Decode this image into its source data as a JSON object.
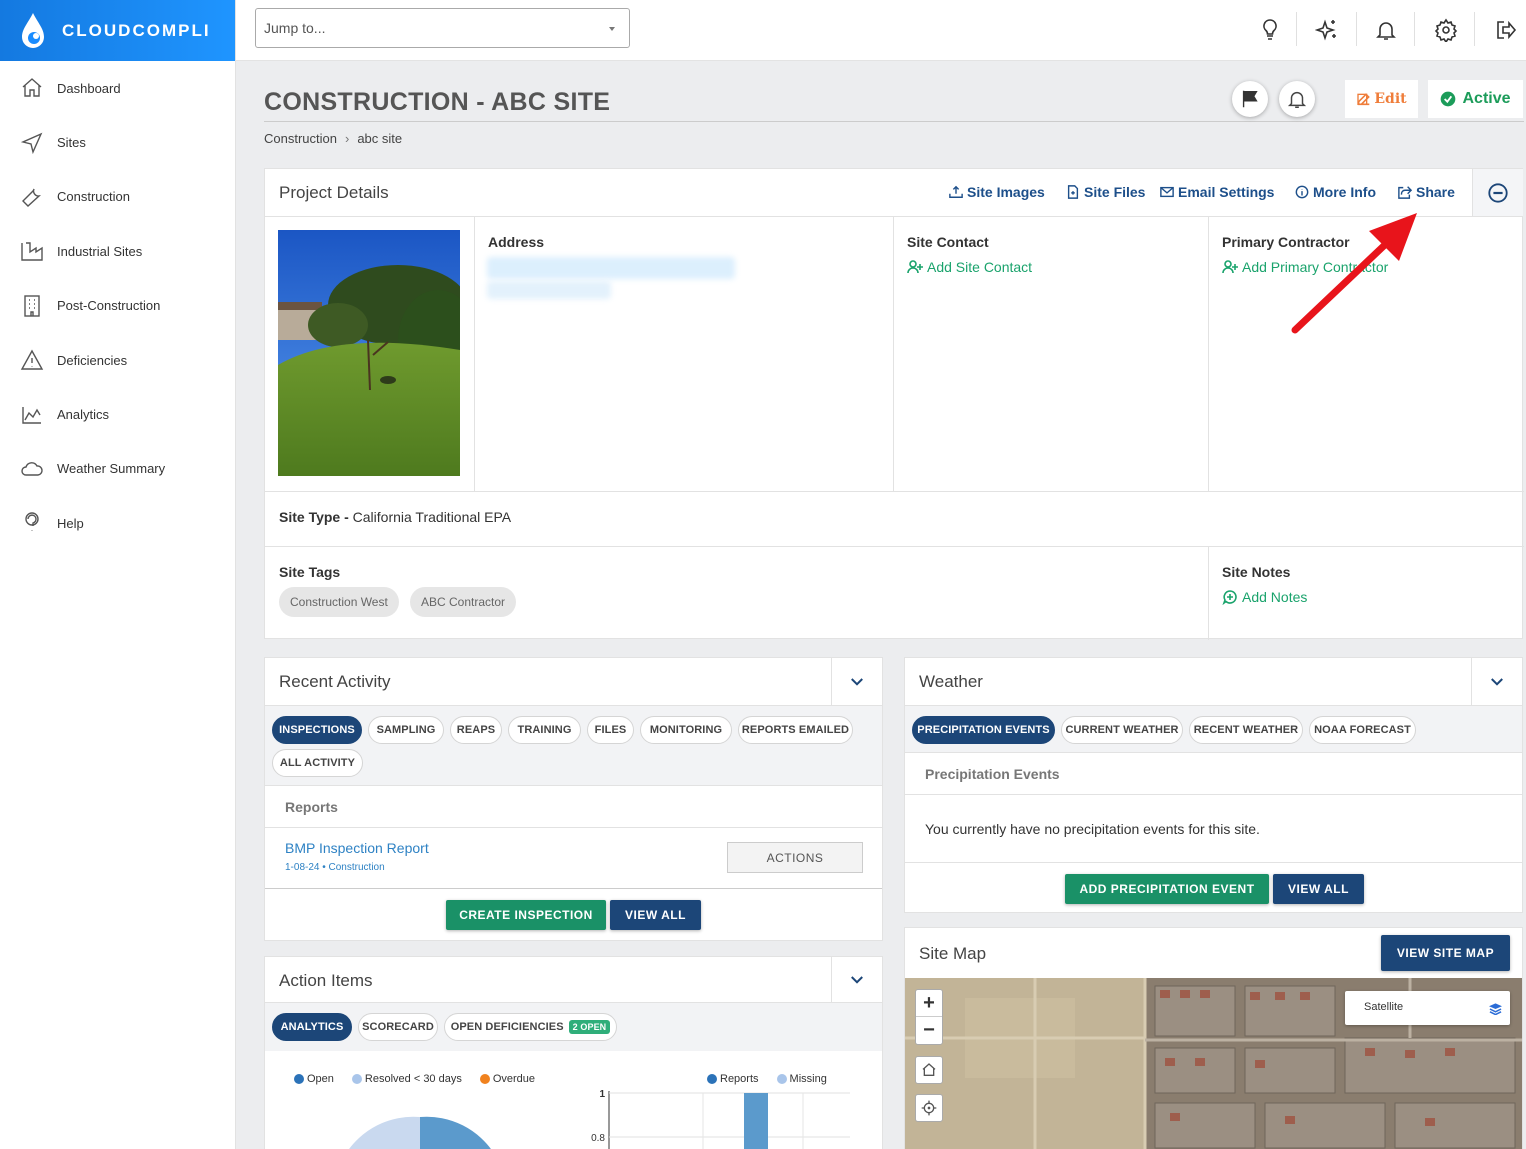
{
  "app": {
    "brand": "CLOUDCOMPLI"
  },
  "sidebar": {
    "items": [
      {
        "label": "Dashboard",
        "icon": "home-icon"
      },
      {
        "label": "Sites",
        "icon": "navigation-icon"
      },
      {
        "label": "Construction",
        "icon": "wrench-icon"
      },
      {
        "label": "Industrial Sites",
        "icon": "factory-icon"
      },
      {
        "label": "Post-Construction",
        "icon": "building-icon"
      },
      {
        "label": "Deficiencies",
        "icon": "warning-icon"
      },
      {
        "label": "Analytics",
        "icon": "chart-icon"
      },
      {
        "label": "Weather Summary",
        "icon": "cloud-icon"
      },
      {
        "label": "Help",
        "icon": "help-icon"
      }
    ]
  },
  "topbar": {
    "jump_placeholder": "Jump to..."
  },
  "header": {
    "title": "CONSTRUCTION - ABC SITE",
    "breadcrumb": [
      "Construction",
      "abc site"
    ],
    "edit_label": "Edit",
    "status_label": "Active"
  },
  "project": {
    "title": "Project Details",
    "links": [
      "Site Images",
      "Site Files",
      "Email Settings",
      "More Info",
      "Share"
    ],
    "address_label": "Address",
    "site_contact_label": "Site Contact",
    "add_site_contact": "Add Site Contact",
    "primary_contractor_label": "Primary Contractor",
    "add_primary_contractor": "Add Primary Contractor",
    "site_type_label": "Site Type -",
    "site_type_value": "California Traditional EPA",
    "site_tags_label": "Site Tags",
    "tags": [
      "Construction West",
      "ABC Contractor"
    ],
    "site_notes_label": "Site Notes",
    "add_notes": "Add Notes"
  },
  "recent_activity": {
    "title": "Recent Activity",
    "tabs": [
      "INSPECTIONS",
      "SAMPLING",
      "REAPS",
      "TRAINING",
      "FILES",
      "MONITORING",
      "REPORTS EMAILED",
      "ALL ACTIVITY"
    ],
    "section_label": "Reports",
    "report_title": "BMP Inspection Report",
    "report_meta": "1-08-24 • Construction",
    "actions_label": "ACTIONS",
    "create_btn": "CREATE INSPECTION",
    "view_all_btn": "VIEW ALL"
  },
  "weather": {
    "title": "Weather",
    "tabs": [
      "PRECIPITATION EVENTS",
      "CURRENT WEATHER",
      "RECENT WEATHER",
      "NOAA FORECAST"
    ],
    "section_label": "Precipitation Events",
    "empty_message": "You currently have no precipitation events for this site.",
    "add_btn": "ADD PRECIPITATION EVENT",
    "view_all_btn": "VIEW ALL"
  },
  "site_map": {
    "title": "Site Map",
    "view_btn": "VIEW SITE MAP",
    "layer_label": "Satellite",
    "zoom_in": "+",
    "zoom_out": "−"
  },
  "action_items": {
    "title": "Action Items",
    "tabs": [
      "ANALYTICS",
      "SCORECARD",
      "OPEN DEFICIENCIES"
    ],
    "open_badge": "2 OPEN",
    "pie_legend": [
      "Open",
      "Resolved < 30 days",
      "Overdue"
    ],
    "bar_legend": [
      "Reports",
      "Missing"
    ],
    "bar_ticks": [
      "1",
      "0.8"
    ]
  },
  "colors": {
    "brand_blue": "#1a8cff",
    "navy": "#1c4678",
    "green": "#1a9167",
    "link_green": "#1aa36c",
    "edit_orange": "#ef7d3a",
    "annotation_red": "#e8141b"
  }
}
